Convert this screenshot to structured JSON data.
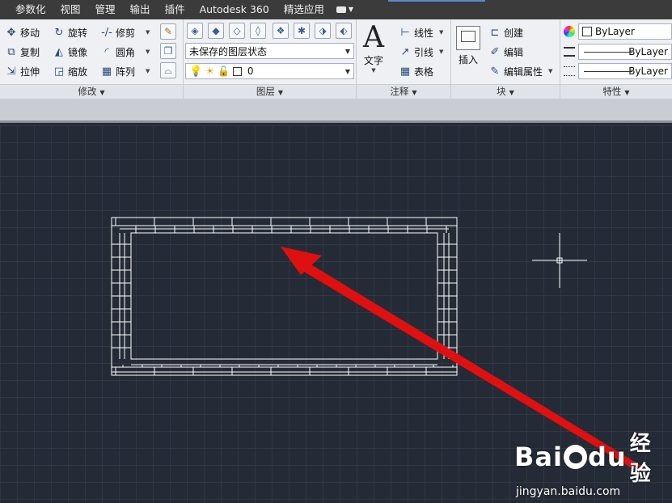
{
  "menu": {
    "items": [
      "参数化",
      "视图",
      "管理",
      "输出",
      "插件",
      "Autodesk 360",
      "精选应用"
    ],
    "cloud_icon": "cloud-icon"
  },
  "ribbon": {
    "modify": {
      "title": "修改",
      "tools": {
        "move": "移动",
        "rotate": "旋转",
        "trim": "修剪",
        "copy": "复制",
        "mirror": "镜像",
        "fillet": "圆角",
        "stretch": "拉伸",
        "scale": "缩放",
        "array": "阵列"
      }
    },
    "layers": {
      "title": "图层",
      "layer_state": "未保存的图层状态",
      "current_layer": "0"
    },
    "annotation": {
      "title": "注释",
      "text": "文字",
      "linear": "线性",
      "leader": "引线",
      "table": "表格"
    },
    "block": {
      "title": "块",
      "insert": "插入",
      "create": "创建",
      "edit": "编辑",
      "edit_attributes": "编辑属性"
    },
    "properties": {
      "title": "特性",
      "color": "ByLayer",
      "linetype": "ByLayer",
      "lineweight": "ByLayer"
    }
  },
  "colors": {
    "canvas": "#252b36",
    "grid": "#303744",
    "arrow": "#e01010",
    "wall": "#ffffff"
  },
  "watermark": {
    "brand_left": "Bai",
    "brand_right": "du",
    "brand_cn": "经验",
    "url": "jingyan.baidu.com"
  }
}
